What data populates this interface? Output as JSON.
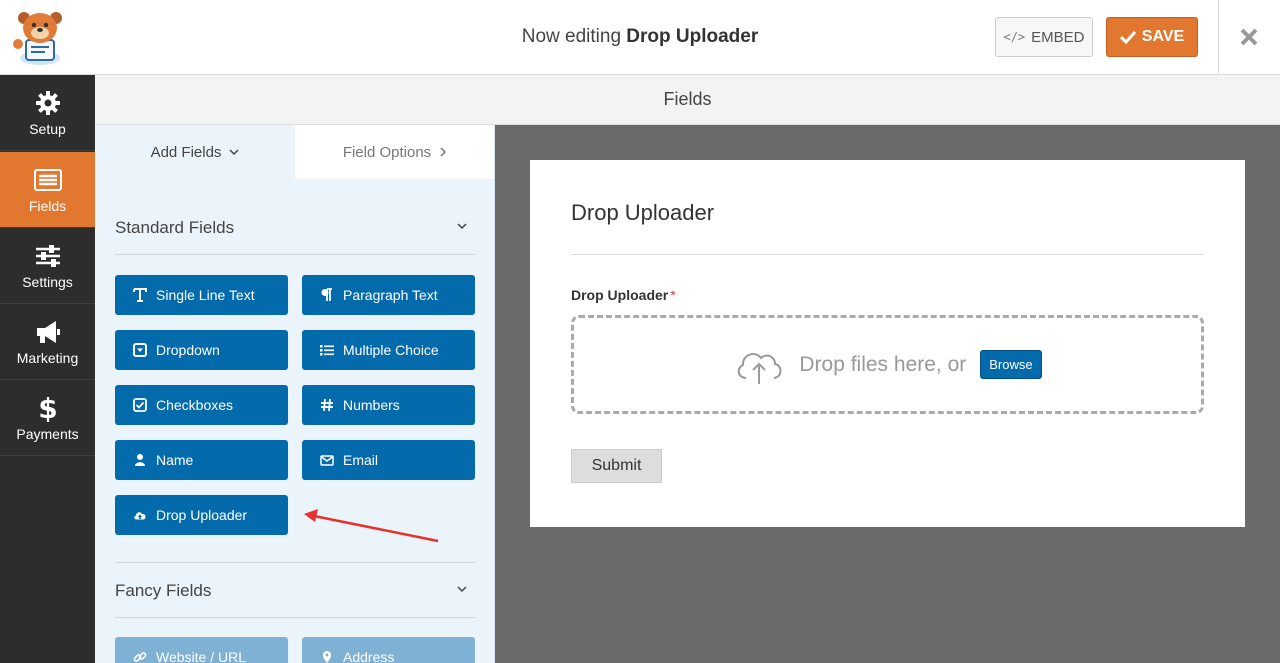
{
  "header": {
    "title_prefix": "Now editing",
    "title_form": "Drop Uploader",
    "embed_label": "EMBED",
    "save_label": "SAVE"
  },
  "sidebar": {
    "items": [
      {
        "label": "Setup",
        "icon": "gear-icon"
      },
      {
        "label": "Fields",
        "icon": "fields-list-icon",
        "active": true
      },
      {
        "label": "Settings",
        "icon": "sliders-icon"
      },
      {
        "label": "Marketing",
        "icon": "megaphone-icon"
      },
      {
        "label": "Payments",
        "icon": "dollar-icon"
      }
    ]
  },
  "fields_header": "Fields",
  "panel": {
    "tabs": {
      "add": "Add Fields",
      "options": "Field Options"
    },
    "standard_title": "Standard Fields",
    "standard_fields": [
      {
        "label": "Single Line Text",
        "icon": "text-icon"
      },
      {
        "label": "Paragraph Text",
        "icon": "paragraph-icon"
      },
      {
        "label": "Dropdown",
        "icon": "dropdown-icon"
      },
      {
        "label": "Multiple Choice",
        "icon": "list-icon"
      },
      {
        "label": "Checkboxes",
        "icon": "checkbox-icon"
      },
      {
        "label": "Numbers",
        "icon": "hash-icon"
      },
      {
        "label": "Name",
        "icon": "user-icon"
      },
      {
        "label": "Email",
        "icon": "envelope-icon"
      },
      {
        "label": "Drop Uploader",
        "icon": "cloud-upload-icon"
      }
    ],
    "fancy_title": "Fancy Fields",
    "fancy_fields": [
      {
        "label": "Website / URL",
        "icon": "link-icon"
      },
      {
        "label": "Address",
        "icon": "map-pin-icon"
      }
    ]
  },
  "form": {
    "title": "Drop Uploader",
    "field_label": "Drop Uploader",
    "required_mark": "*",
    "drop_text": "Drop files here, or",
    "browse_label": "Browse",
    "submit_label": "Submit"
  },
  "colors": {
    "accent_orange": "#e27730",
    "field_button_blue": "#036aab",
    "sidebar_dark": "#2d2d2d",
    "annotation_arrow": "#e8312a"
  }
}
